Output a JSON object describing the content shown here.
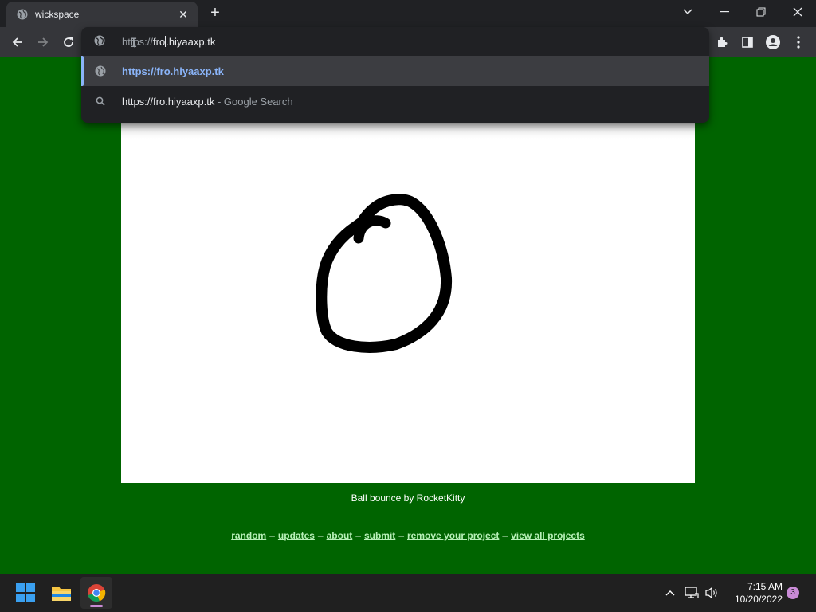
{
  "browser": {
    "tab": {
      "title": "wickspace",
      "close_glyph": "✕"
    },
    "new_tab_glyph": "+",
    "window_controls": {
      "minimize": "—",
      "restore": "❐",
      "close": "✕"
    }
  },
  "omnibox": {
    "input": {
      "scheme": "https://",
      "host_before_caret": "fro",
      "host_after_caret": ".hiyaaxp.tk"
    },
    "suggestions": [
      {
        "icon": "globe-icon",
        "url": "https://fro.hiyaaxp.tk",
        "selected": true
      },
      {
        "icon": "search-icon",
        "query": "https://fro.hiyaaxp.tk",
        "suffix": " - Google Search",
        "selected": false
      }
    ]
  },
  "page": {
    "caption": "Ball bounce by RocketKitty",
    "footer_links": [
      "random",
      "updates",
      "about",
      "submit",
      "remove your project",
      "view all projects"
    ],
    "separator": "–",
    "background_color": "#006400"
  },
  "taskbar": {
    "apps": [
      "start",
      "file-explorer",
      "chrome"
    ],
    "clock_time": "7:15 AM",
    "clock_date": "10/20/2022",
    "notification_count": "3"
  }
}
